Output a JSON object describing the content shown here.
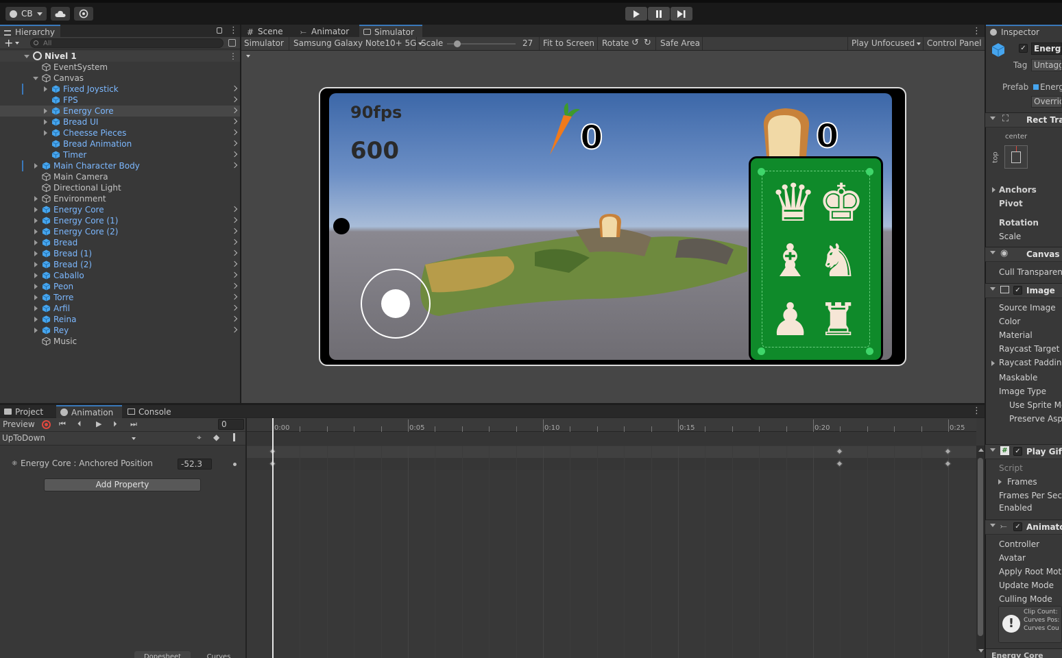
{
  "toolbar": {
    "account": "CB",
    "play": "▶",
    "pause": "❚❚",
    "step": "▶❙"
  },
  "hierarchy": {
    "tab": "Hierarchy",
    "search_placeholder": "All",
    "scene": "Nivel 1",
    "items": [
      {
        "label": "EventSystem",
        "depth": 1,
        "prefab": false,
        "arrow": "none"
      },
      {
        "label": "Canvas",
        "depth": 1,
        "prefab": false,
        "arrow": "open"
      },
      {
        "label": "Fixed Joystick",
        "depth": 2,
        "prefab": true,
        "arrow": "closed"
      },
      {
        "label": "FPS",
        "depth": 2,
        "prefab": true,
        "arrow": "none"
      },
      {
        "label": "Energy Core",
        "depth": 2,
        "prefab": true,
        "arrow": "closed",
        "selected": true
      },
      {
        "label": "Bread UI",
        "depth": 2,
        "prefab": true,
        "arrow": "closed"
      },
      {
        "label": "Cheesse Pieces",
        "depth": 2,
        "prefab": true,
        "arrow": "closed"
      },
      {
        "label": "Bread Animation",
        "depth": 2,
        "prefab": true,
        "arrow": "none"
      },
      {
        "label": "Timer",
        "depth": 2,
        "prefab": true,
        "arrow": "none"
      },
      {
        "label": "Main Character Body",
        "depth": 1,
        "prefab": true,
        "arrow": "closed"
      },
      {
        "label": "Main Camera",
        "depth": 1,
        "prefab": false,
        "arrow": "none"
      },
      {
        "label": "Directional Light",
        "depth": 1,
        "prefab": false,
        "arrow": "none"
      },
      {
        "label": "Environment",
        "depth": 1,
        "prefab": false,
        "arrow": "closed"
      },
      {
        "label": "Energy Core",
        "depth": 1,
        "prefab": true,
        "arrow": "closed"
      },
      {
        "label": "Energy Core (1)",
        "depth": 1,
        "prefab": true,
        "arrow": "closed"
      },
      {
        "label": "Energy Core (2)",
        "depth": 1,
        "prefab": true,
        "arrow": "closed"
      },
      {
        "label": "Bread",
        "depth": 1,
        "prefab": true,
        "arrow": "closed"
      },
      {
        "label": "Bread (1)",
        "depth": 1,
        "prefab": true,
        "arrow": "closed"
      },
      {
        "label": "Bread (2)",
        "depth": 1,
        "prefab": true,
        "arrow": "closed"
      },
      {
        "label": "Caballo",
        "depth": 1,
        "prefab": true,
        "arrow": "closed"
      },
      {
        "label": "Peon",
        "depth": 1,
        "prefab": true,
        "arrow": "closed"
      },
      {
        "label": "Torre",
        "depth": 1,
        "prefab": true,
        "arrow": "closed"
      },
      {
        "label": "Arfil",
        "depth": 1,
        "prefab": true,
        "arrow": "closed"
      },
      {
        "label": "Reina",
        "depth": 1,
        "prefab": true,
        "arrow": "closed"
      },
      {
        "label": "Rey",
        "depth": 1,
        "prefab": true,
        "arrow": "closed"
      },
      {
        "label": "Music",
        "depth": 1,
        "prefab": false,
        "arrow": "none"
      }
    ]
  },
  "views": {
    "tabs": [
      "Scene",
      "Animator",
      "Simulator"
    ],
    "active_tab": "Simulator",
    "simulator_dropdown": "Simulator",
    "device": "Samsung Galaxy Note10+ 5G",
    "scale_label": "Scale",
    "scale_value": "27",
    "scale_fraction": 0.15,
    "fit_to_screen": "Fit to Screen",
    "rotate": "Rotate",
    "safe_area": "Safe Area",
    "play_unfocused": "Play Unfocused",
    "control_panel": "Control Panel"
  },
  "game": {
    "fps": "90fps",
    "timer": "600",
    "carrot_count": "0",
    "bread_count": "0"
  },
  "bottom": {
    "tabs": [
      "Project",
      "Animation",
      "Console"
    ],
    "active_tab": "Animation",
    "preview": "Preview",
    "frame": "0",
    "clip": "UpToDown",
    "property": "Energy Core : Anchored Position",
    "property_value": "-52.3",
    "add_property": "Add Property",
    "time_labels": [
      "0:00",
      "0:05",
      "0:10",
      "0:15",
      "0:20",
      "0:25"
    ],
    "keyframe_times": [
      0,
      21,
      25
    ],
    "footer_tabs": [
      "Dopesheet",
      "Curves"
    ]
  },
  "inspector": {
    "tab": "Inspector",
    "object_name": "Energy",
    "tag_label": "Tag",
    "tag_value": "Untagg",
    "prefab_label": "Prefab",
    "prefab_value": "Energ",
    "overrides": "Overrid",
    "rect_transform": "Rect Tra",
    "anchor_preset_h": "center",
    "anchor_preset_v": "top",
    "rect_fields": [
      "Anchors",
      "Pivot",
      "Rotation",
      "Scale"
    ],
    "canvas_renderer": "Canvas R",
    "cull": "Cull Transparent",
    "image": "Image",
    "image_fields": [
      "Source Image",
      "Color",
      "Material",
      "Raycast Target",
      "Raycast Padding",
      "Maskable",
      "Image Type",
      "Use Sprite Me",
      "Preserve Aspe"
    ],
    "play_gif": "Play Gif (",
    "gif_fields": [
      "Script",
      "Frames",
      "Frames Per Seco",
      "Enabled"
    ],
    "animator": "Animator",
    "animator_fields": [
      "Controller",
      "Avatar",
      "Apply Root Motio",
      "Update Mode",
      "Culling Mode"
    ],
    "info_box": [
      "Clip Count:",
      "Curves Pos:",
      "Curves Cou"
    ],
    "footer": "Energy Core"
  },
  "colors": {
    "accent": "#3a79bb",
    "prefab_text": "#7cb8ff",
    "card_green": "#0f8a2a",
    "record": "#e0483e"
  }
}
